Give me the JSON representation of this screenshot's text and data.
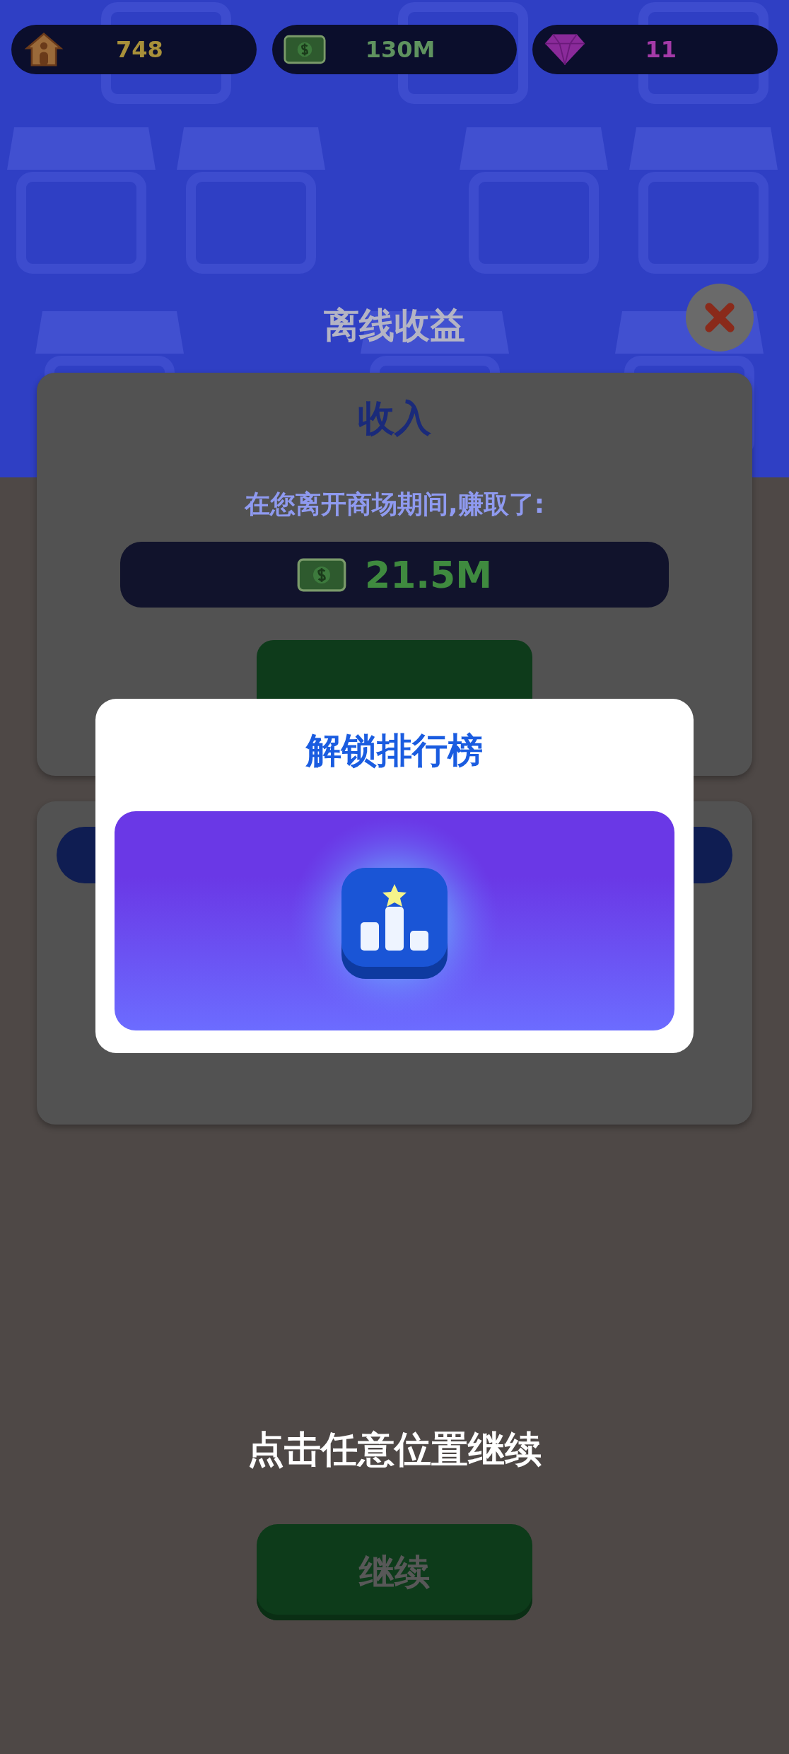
{
  "resources": [
    {
      "kind": "houses",
      "value": "748"
    },
    {
      "kind": "cash",
      "value": "130M"
    },
    {
      "kind": "gems",
      "value": "11"
    }
  ],
  "header": {
    "title": "离线收益"
  },
  "income_card": {
    "title": "收入",
    "message": "在您离开商场期间,赚取了:",
    "amount": "21.5M"
  },
  "popup": {
    "title": "解锁排行榜"
  },
  "hint": "点击任意位置继续",
  "continue_button": {
    "label": "继续"
  }
}
